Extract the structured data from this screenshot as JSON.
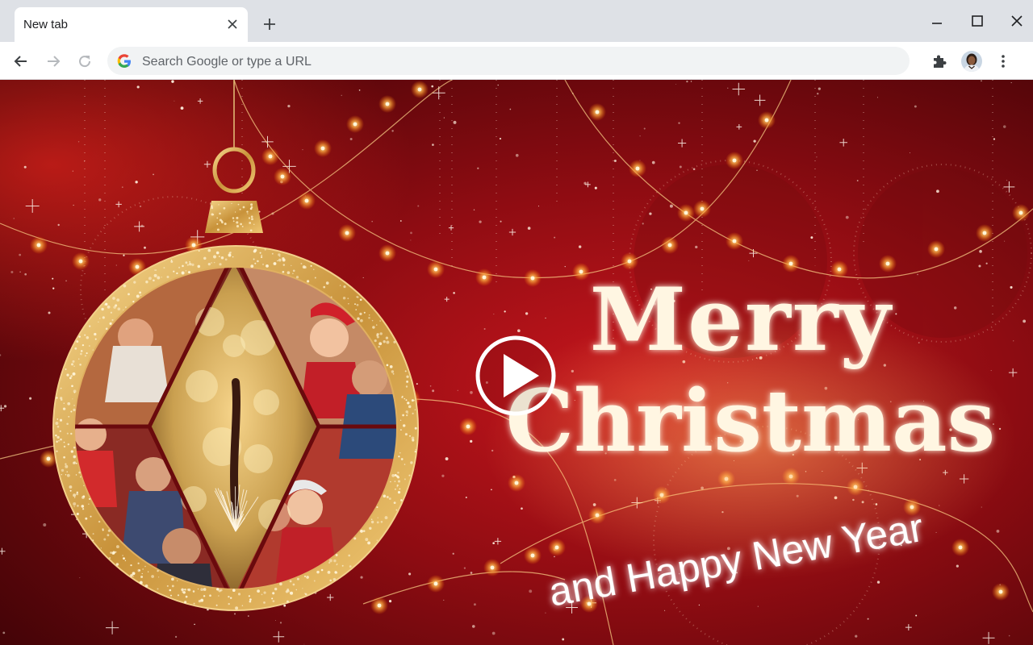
{
  "tab": {
    "title": "New tab"
  },
  "omnibox": {
    "placeholder": "Search Google or type a URL"
  },
  "greeting": {
    "line1": "Merry",
    "line2": "Christmas",
    "line3": "and Happy New Year"
  },
  "colors": {
    "chrome_bg": "#dee1e6",
    "toolbar_bg": "#ffffff",
    "omnibox_bg": "#f1f3f4",
    "page_red": "#8e0c12",
    "gold": "#d9a441"
  },
  "icons": {
    "back": "arrow-left",
    "forward": "arrow-right",
    "reload": "reload",
    "google": "google-g",
    "extensions": "puzzle",
    "menu": "three-dots-vertical",
    "play": "play-triangle"
  }
}
